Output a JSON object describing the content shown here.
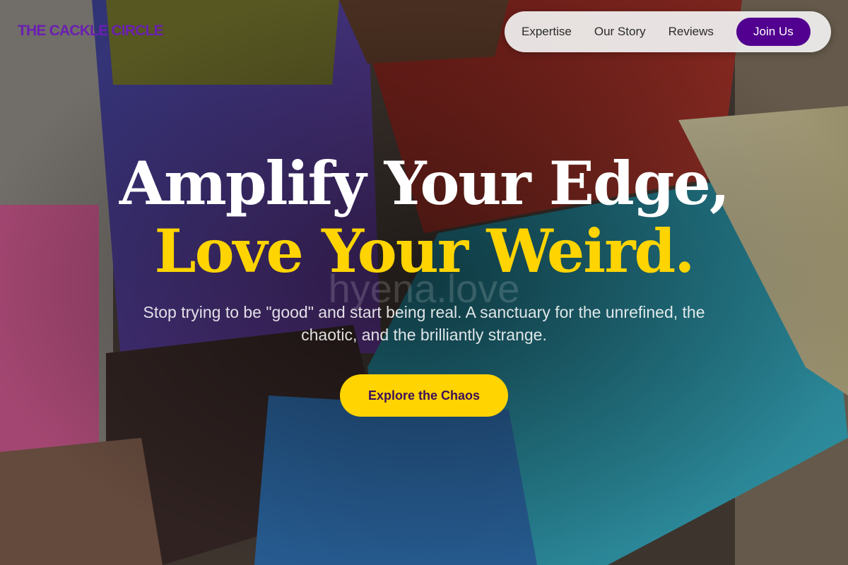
{
  "header": {
    "logo_text": "THE CACKLE CIRCLE"
  },
  "nav": {
    "links": [
      "Expertise",
      "Our Story",
      "Reviews"
    ],
    "cta_label": "Join Us"
  },
  "hero": {
    "headline_line1": "Amplify Your Edge,",
    "headline_line2": "Love Your Weird.",
    "watermark": "hyena.love",
    "subtitle": "Stop trying to be \"good\" and start being real. A sanctuary for the unrefined, the chaotic, and the brilliantly strange.",
    "cta_label": "Explore the Chaos"
  },
  "colors": {
    "brand_purple": "#51008f",
    "logo_purple": "#6a1fb0",
    "accent_yellow": "#ffd400",
    "cta_text": "#3d0f5c"
  }
}
